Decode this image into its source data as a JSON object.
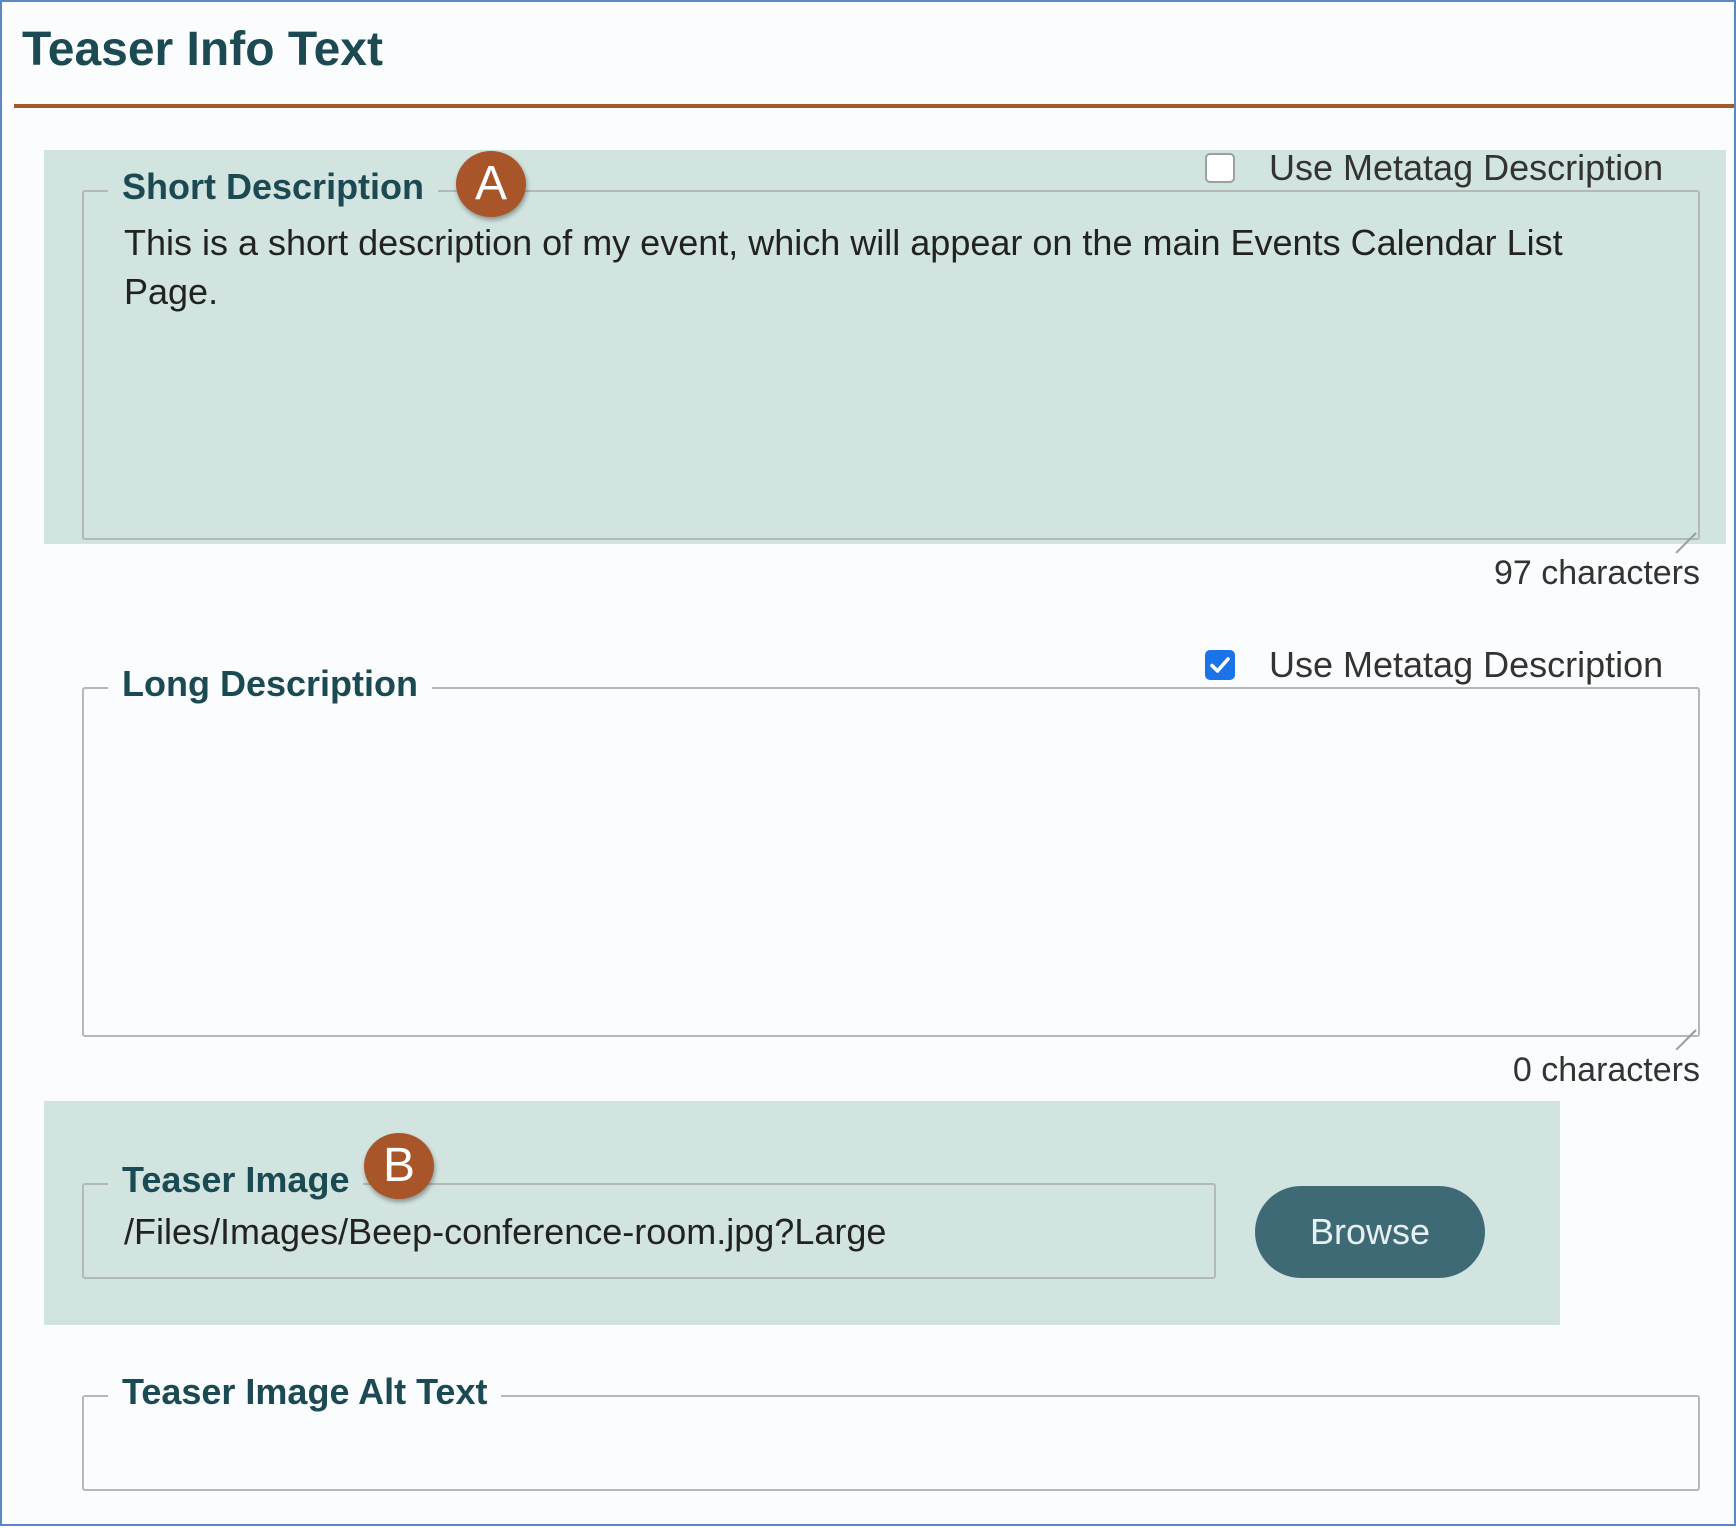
{
  "section": {
    "title": "Teaser Info Text"
  },
  "short_description": {
    "legend": "Short Description",
    "marker": "A",
    "checkbox_label": "Use Metatag Description",
    "checkbox_checked": false,
    "value": "This is a short description of my event, which will appear on the main Events Calendar List Page.",
    "char_count": "97 characters"
  },
  "long_description": {
    "legend": "Long Description",
    "checkbox_label": "Use Metatag Description",
    "checkbox_checked": true,
    "value": "",
    "char_count": "0 characters"
  },
  "teaser_image": {
    "legend": "Teaser Image",
    "marker": "B",
    "value": "/Files/Images/Beep-conference-room.jpg?Large",
    "browse_label": "Browse"
  },
  "teaser_alt_text": {
    "legend": "Teaser Image Alt Text",
    "value": ""
  },
  "colors": {
    "heading": "#1b4a52",
    "rule": "#a35a2b",
    "highlight": "#d2e4e0",
    "marker": "#a9552a",
    "button": "#3e6a75",
    "checkbox_checked": "#1a73e8"
  }
}
